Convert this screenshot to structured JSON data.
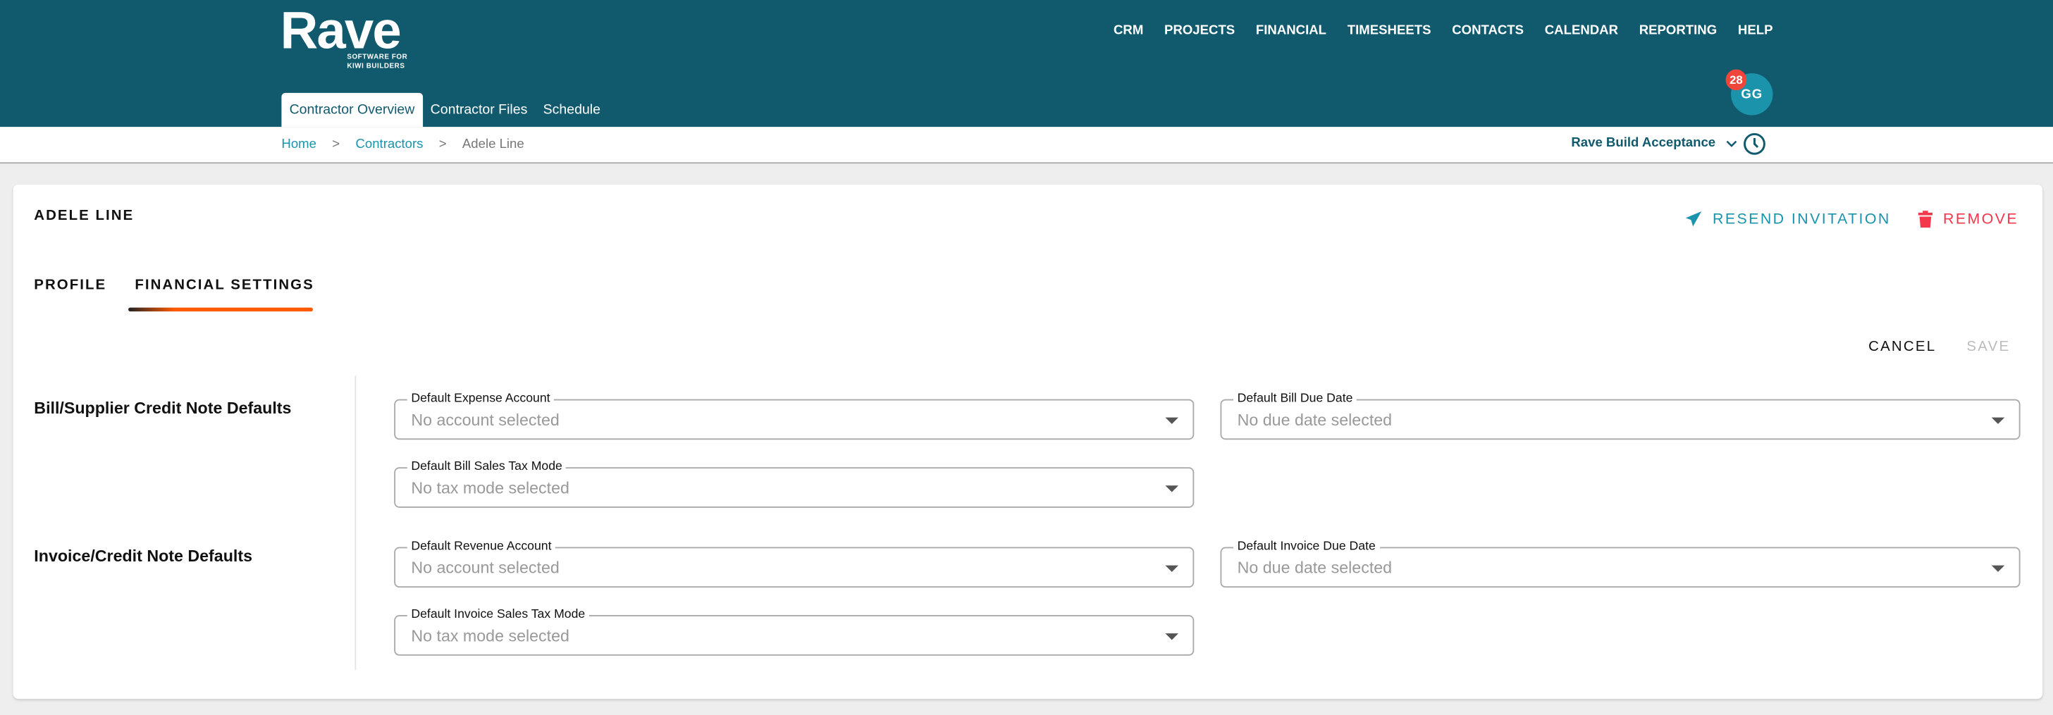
{
  "header": {
    "logo": "Rave",
    "logo_tagline_1": "SOFTWARE FOR",
    "logo_tagline_2": "KIWI BUILDERS",
    "nav": [
      "CRM",
      "PROJECTS",
      "FINANCIAL",
      "TIMESHEETS",
      "CONTACTS",
      "CALENDAR",
      "REPORTING",
      "HELP"
    ],
    "avatar_initials": "GG",
    "notification_count": "28",
    "subtabs": [
      "Contractor Overview",
      "Contractor Files",
      "Schedule"
    ]
  },
  "breadcrumb": {
    "home": "Home",
    "sep": ">",
    "contractors": "Contractors",
    "current": "Adele Line"
  },
  "company_selector": "Rave Build Acceptance",
  "contractor": {
    "name": "ADELE LINE",
    "resend_label": "RESEND INVITATION",
    "remove_label": "REMOVE",
    "tabs": [
      "PROFILE",
      "FINANCIAL SETTINGS"
    ],
    "cancel_label": "CANCEL",
    "save_label": "SAVE"
  },
  "sections": [
    {
      "title": "Bill/Supplier Credit Note Defaults",
      "fields": [
        {
          "label": "Default Expense Account",
          "value": "No account selected"
        },
        {
          "label": "Default Bill Due Date",
          "value": "No due date selected"
        },
        {
          "label": "Default Bill Sales Tax Mode",
          "value": "No tax mode selected"
        }
      ]
    },
    {
      "title": "Invoice/Credit Note Defaults",
      "fields": [
        {
          "label": "Default Revenue Account",
          "value": "No account selected"
        },
        {
          "label": "Default Invoice Due Date",
          "value": "No due date selected"
        },
        {
          "label": "Default Invoice Sales Tax Mode",
          "value": "No tax mode selected"
        }
      ]
    }
  ],
  "colors": {
    "header": "#115a6e",
    "accent": "#1a93ab",
    "danger": "#f2384a",
    "tab_indicator": "#ff5a00"
  }
}
